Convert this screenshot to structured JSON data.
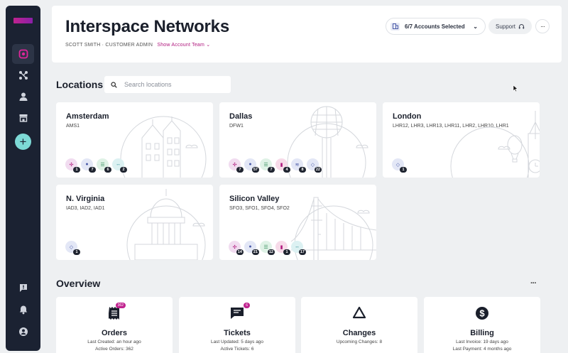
{
  "sidebar": {
    "items": [
      {
        "name": "dashboard-icon"
      },
      {
        "name": "network-icon"
      },
      {
        "name": "user-icon"
      },
      {
        "name": "store-icon"
      },
      {
        "name": "chat-icon"
      },
      {
        "name": "bell-icon"
      },
      {
        "name": "account-icon"
      }
    ],
    "add_label": "+"
  },
  "header": {
    "title": "Interspace Networks",
    "user": "SCOTT SMITH · CUSTOMER ADMIN",
    "team_link": "Show Account Team",
    "accounts": "6/7 Accounts Selected",
    "support": "Support",
    "more": "···"
  },
  "locations": {
    "title": "Locations",
    "search_placeholder": "Search locations",
    "cards": [
      {
        "name": "Amsterdam",
        "codes": "AMS1",
        "badges": [
          "1",
          "7",
          "6",
          "2"
        ]
      },
      {
        "name": "Dallas",
        "codes": "DFW1",
        "badges": [
          "7",
          "57",
          "7",
          "4",
          "8",
          "22"
        ]
      },
      {
        "name": "London",
        "codes": "LHR12, LHR3, LHR13, LHR11, LHR2, LHR10, LHR1",
        "badges": [
          "1"
        ]
      },
      {
        "name": "N. Virginia",
        "codes": "IAD3, IAD2, IAD1",
        "badges": [
          "1"
        ]
      },
      {
        "name": "Silicon Valley",
        "codes": "SFO3, SFO1, SFO4, SFO2",
        "badges": [
          "14",
          "21",
          "12",
          "1",
          "17"
        ]
      }
    ]
  },
  "overview": {
    "title": "Overview",
    "more": "···",
    "cards": [
      {
        "name": "Orders",
        "line1": "Last Created: an hour ago",
        "line2": "Active Orders: 362",
        "badge": "362"
      },
      {
        "name": "Tickets",
        "line1": "Last Updated: 5 days ago",
        "line2": "Active Tickets: 6",
        "badge": "6"
      },
      {
        "name": "Changes",
        "line1": "Upcoming Changes: 8",
        "line2": ""
      },
      {
        "name": "Billing",
        "line1": "Last Invoice: 19 days ago",
        "line2": "Last Payment: 4 months ago"
      }
    ]
  },
  "colors": {
    "sidebar": "#1b2232",
    "accent": "#b0197e",
    "add_button": "#7dd9d6",
    "badge_purple": "#f1dcf0",
    "badge_blue": "#e3e7f6",
    "badge_green": "#dff2e6",
    "badge_pink": "#f7dbe9",
    "badge_teal": "#dcf1f2"
  }
}
